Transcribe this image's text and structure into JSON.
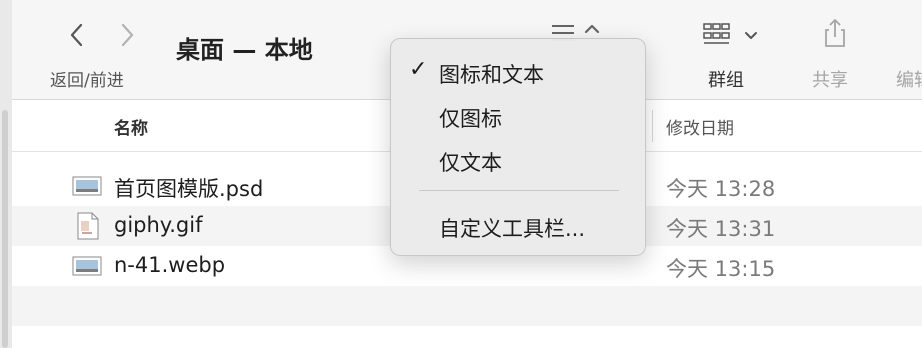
{
  "toolbar": {
    "title": "桌面 — 本地",
    "nav_label": "返回/前进",
    "group_label": "群组",
    "share_label": "共享",
    "edit_label": "编辑"
  },
  "columns": {
    "name": "名称",
    "date": "修改日期"
  },
  "files": [
    {
      "name": "首页图模版.psd",
      "date": "今天 13:28",
      "icon": "image-file-icon"
    },
    {
      "name": "giphy.gif",
      "date": "今天 13:31",
      "icon": "gif-file-icon"
    },
    {
      "name": "n-41.webp",
      "date": "今天 13:15",
      "icon": "image-file-icon"
    }
  ],
  "menu": {
    "items": [
      {
        "label": "图标和文本",
        "checked": "✓"
      },
      {
        "label": "仅图标",
        "checked": ""
      },
      {
        "label": "仅文本",
        "checked": ""
      }
    ],
    "customize": "自定义工具栏..."
  },
  "colors": {
    "toolbar_bg": "#f6f6f6",
    "menu_bg": "#eaeaea",
    "row_alt": "#f4f4f4"
  }
}
